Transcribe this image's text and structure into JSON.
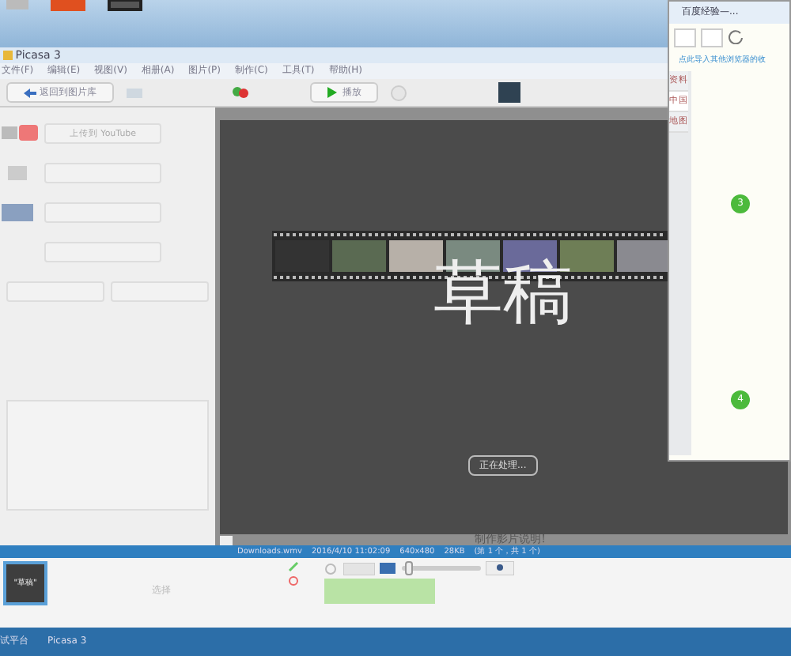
{
  "window": {
    "title": "Picasa 3"
  },
  "menu": [
    "文件(F)",
    "编辑(E)",
    "视图(V)",
    "相册(A)",
    "图片(P)",
    "制作(C)",
    "工具(T)",
    "帮助(H)"
  ],
  "toolbar": {
    "back_button": "返回到图片库",
    "play_button": "播放"
  },
  "left_panel": {
    "buttons": [
      {
        "kind": "youtube",
        "label": "上传到 YouTube"
      },
      {
        "kind": "clip"
      },
      {
        "kind": "film"
      },
      {
        "kind": "plain"
      }
    ]
  },
  "preview": {
    "draft_text": "草稿",
    "status_button": "正在处理...",
    "caption": "制作影片说明!"
  },
  "info_bar": [
    "Downloads.wmv",
    "2016/4/10 11:02:09",
    "640x480",
    "28KB",
    "(第 1 个，共 1 个)"
  ],
  "tray": {
    "thumbnail_label": "\"草稿\"",
    "hint": "选择",
    "zoom_slider": {
      "level": 0.05
    }
  },
  "taskbar": [
    "试平台",
    "Picasa 3"
  ],
  "browser_popup": {
    "tab_title": "百度经验—...",
    "import_link": "点此导入其他浏览器的收",
    "side_items": [
      {
        "label": "资料",
        "selected": false
      },
      {
        "label": "中国",
        "selected": true
      },
      {
        "label": "地图",
        "selected": false
      }
    ],
    "steps": [
      "3",
      "4"
    ]
  }
}
